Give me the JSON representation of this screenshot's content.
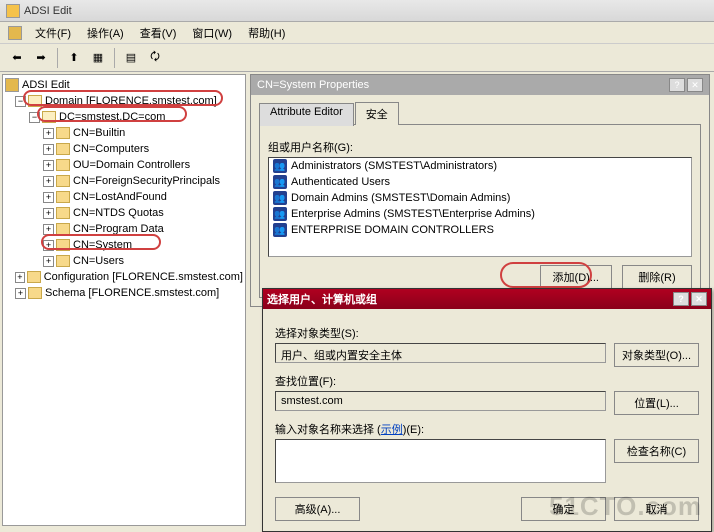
{
  "appTitle": "ADSI Edit",
  "menu": {
    "file": "文件(F)",
    "action": "操作(A)",
    "view": "查看(V)",
    "window": "窗口(W)",
    "help": "帮助(H)"
  },
  "tree": {
    "root": "ADSI Edit",
    "domain": "Domain [FLORENCE.smstest.com]",
    "dc": "DC=smstest,DC=com",
    "items": [
      "CN=Builtin",
      "CN=Computers",
      "OU=Domain Controllers",
      "CN=ForeignSecurityPrincipals",
      "CN=LostAndFound",
      "CN=NTDS Quotas",
      "CN=Program Data",
      "CN=System",
      "CN=Users"
    ],
    "config": "Configuration [FLORENCE.smstest.com]",
    "schema": "Schema [FLORENCE.smstest.com]"
  },
  "properties": {
    "title": "CN=System Properties",
    "tabs": {
      "attr": "Attribute Editor",
      "sec": "安全"
    },
    "groupLabel": "组或用户名称(G):",
    "users": [
      "Administrators (SMSTEST\\Administrators)",
      "Authenticated Users",
      "Domain Admins (SMSTEST\\Domain Admins)",
      "Enterprise Admins (SMSTEST\\Enterprise Admins)",
      "ENTERPRISE DOMAIN CONTROLLERS"
    ],
    "addBtn": "添加(D)...",
    "removeBtn": "删除(R)"
  },
  "dialog": {
    "title": "选择用户、计算机或组",
    "objTypeLabel": "选择对象类型(S):",
    "objTypeValue": "用户、组或内置安全主体",
    "objTypeBtn": "对象类型(O)...",
    "locLabel": "查找位置(F):",
    "locValue": "smstest.com",
    "locBtn": "位置(L)...",
    "nameLabel": "输入对象名称来选择 (",
    "nameLink": "示例",
    "nameLabel2": ")(E):",
    "checkBtn": "检查名称(C)",
    "advBtn": "高级(A)...",
    "okBtn": "确定",
    "cancelBtn": "取消"
  },
  "watermark": "51CTO.com"
}
